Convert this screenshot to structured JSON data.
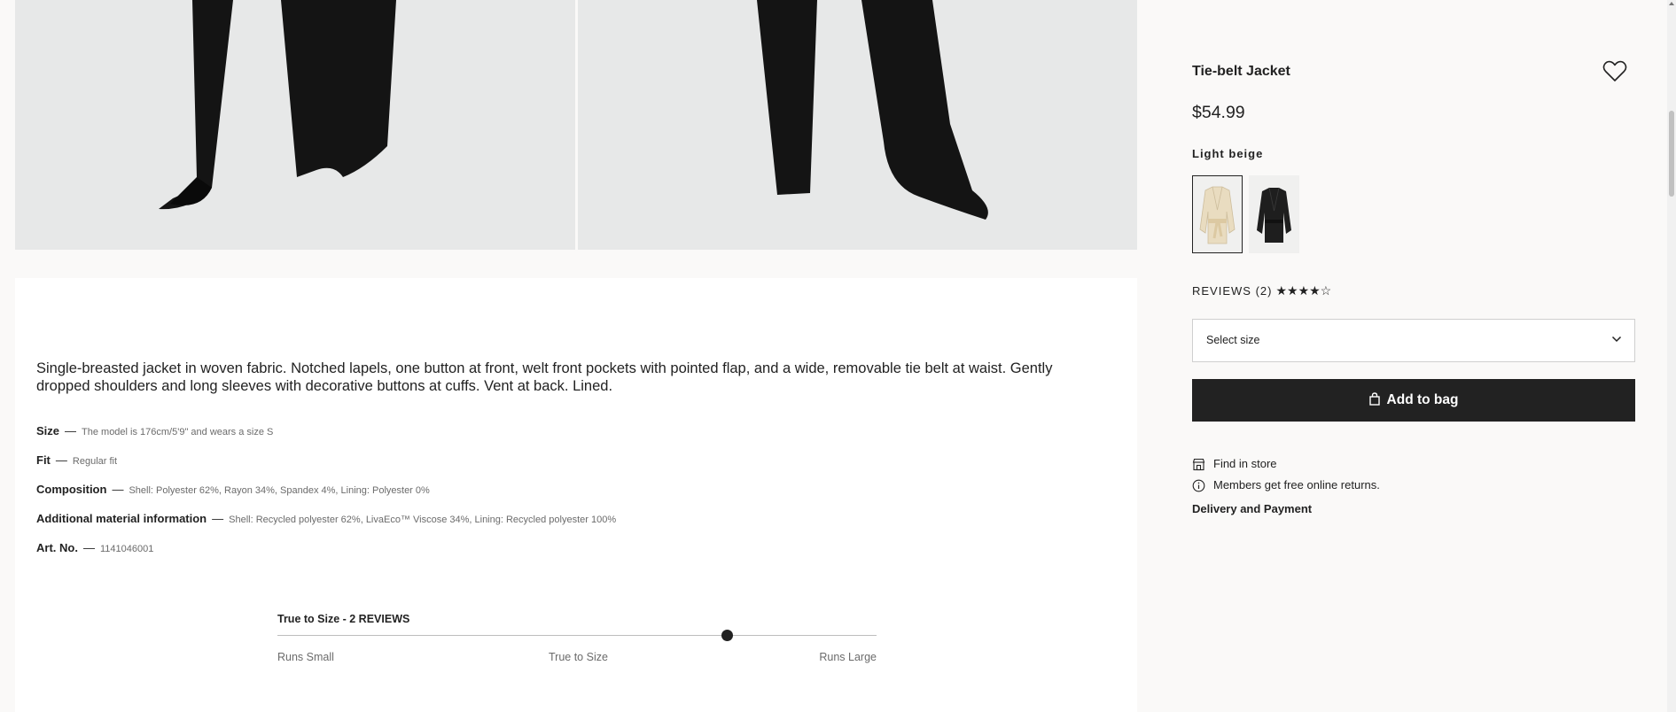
{
  "product": {
    "title": "Tie-belt Jacket",
    "price": "$54.99",
    "color_name": "Light beige",
    "swatches": [
      {
        "name": "Light beige jacket",
        "selected": true
      },
      {
        "name": "Black jacket",
        "selected": false
      }
    ],
    "reviews_label": "REVIEWS (2)",
    "rating_stars": "★★★★☆",
    "rating": 4.5,
    "size_select_label": "Select size",
    "add_to_bag_label": "Add to bag",
    "find_in_store_label": "Find in store",
    "members_label": "Members get free online returns.",
    "delivery_label": "Delivery and Payment"
  },
  "description": {
    "text": "Single-breasted jacket in woven fabric. Notched lapels, one button at front, welt front pockets with pointed flap, and a wide, removable tie belt at waist. Gently dropped shoulders and long sleeves with decorative buttons at cuffs. Vent at back. Lined.",
    "specs": [
      {
        "key": "Size",
        "value": "The model is 176cm/5'9\" and wears a size S"
      },
      {
        "key": "Fit",
        "value": "Regular fit"
      },
      {
        "key": "Composition",
        "value": "Shell: Polyester 62%, Rayon 34%, Spandex 4%,  Lining: Polyester 0%"
      },
      {
        "key": "Additional material information",
        "value": "Shell: Recycled polyester 62%, LivaEco™ Viscose 34%,  Lining: Recycled polyester 100%"
      },
      {
        "key": "Art. No.",
        "value": "1141046001"
      }
    ],
    "dash": "—"
  },
  "fit": {
    "title": "True to Size - 2 REVIEWS",
    "small_label": "Runs Small",
    "true_label": "True to Size",
    "large_label": "Runs Large",
    "position": 0.75
  },
  "colors": {
    "accent": "#222222",
    "background": "#faf9f8",
    "panel": "#ffffff"
  }
}
